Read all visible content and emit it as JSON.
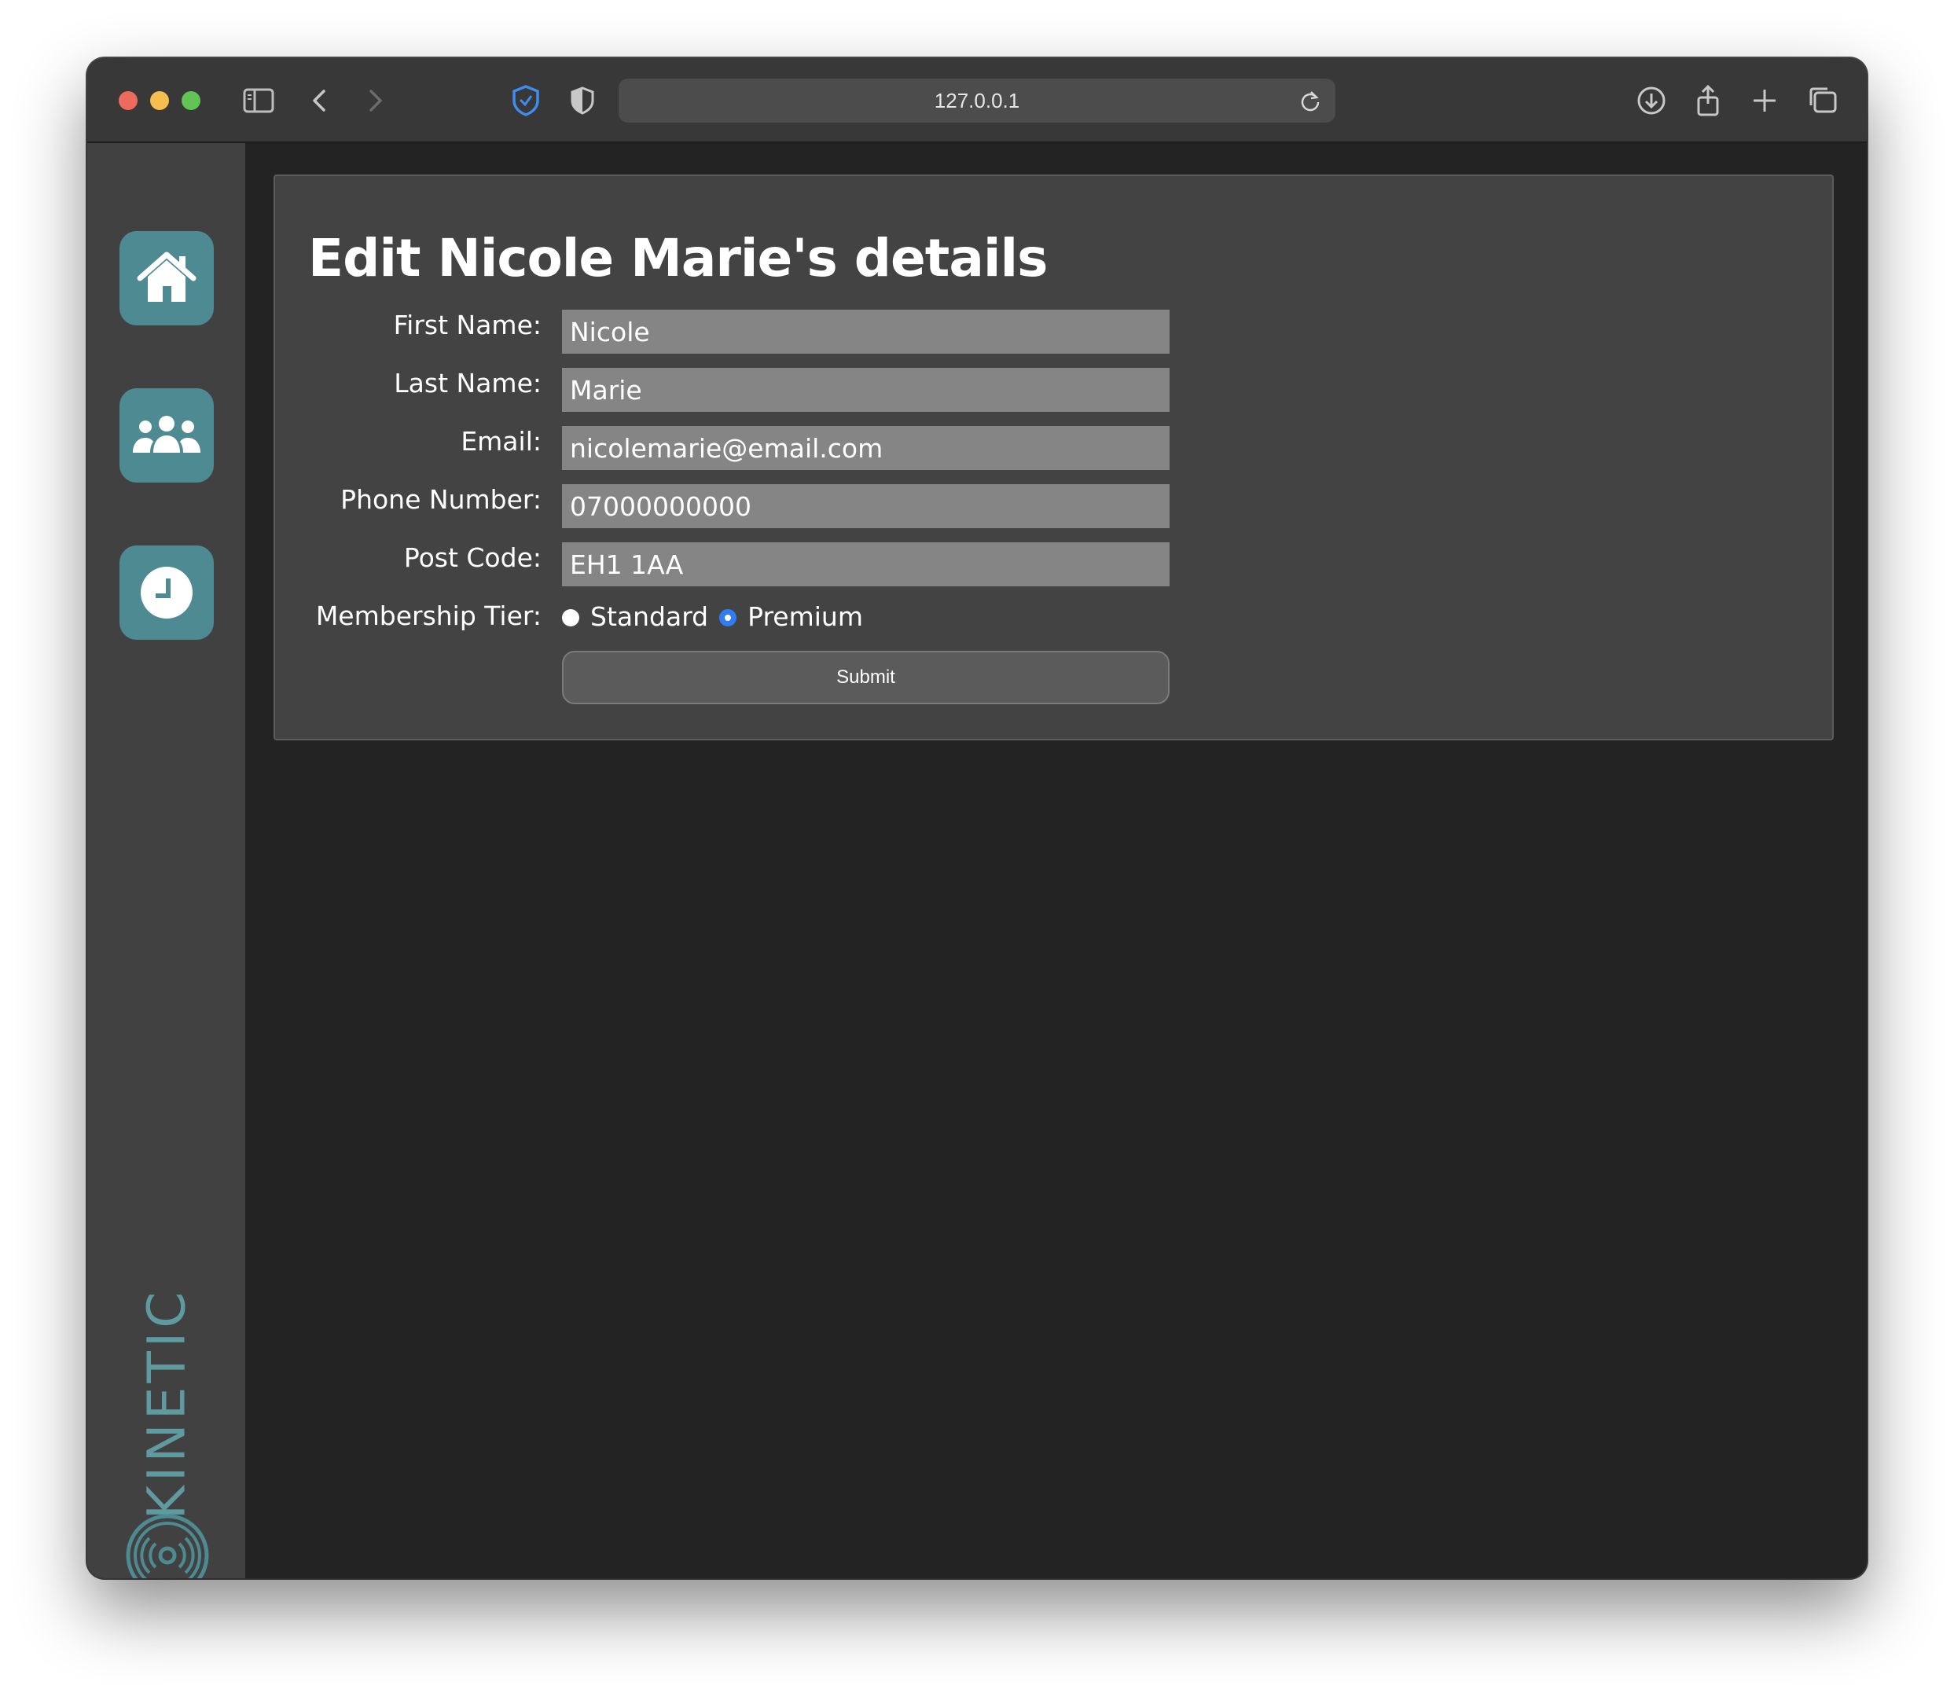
{
  "browser": {
    "url": "127.0.0.1"
  },
  "sidebar": {
    "items": [
      {
        "name": "home",
        "icon": "home-icon"
      },
      {
        "name": "members",
        "icon": "users-icon"
      },
      {
        "name": "history",
        "icon": "clock-icon"
      }
    ],
    "brand": "KINETIC"
  },
  "form": {
    "title": "Edit Nicole Marie's details",
    "first_name_label": "First Name:",
    "first_name_value": "Nicole",
    "last_name_label": "Last Name:",
    "last_name_value": "Marie",
    "email_label": "Email:",
    "email_value": "nicolemarie@email.com",
    "phone_label": "Phone Number:",
    "phone_value": "07000000000",
    "postcode_label": "Post Code:",
    "postcode_value": "EH1 1AA",
    "tier_label": "Membership Tier:",
    "tier_options": [
      "Standard",
      "Premium"
    ],
    "tier_selected": "Premium",
    "submit_label": "Submit"
  },
  "colors": {
    "accent": "#4e8a92",
    "brand": "#5f9aa1",
    "radio_selected": "#2f7cf6"
  }
}
